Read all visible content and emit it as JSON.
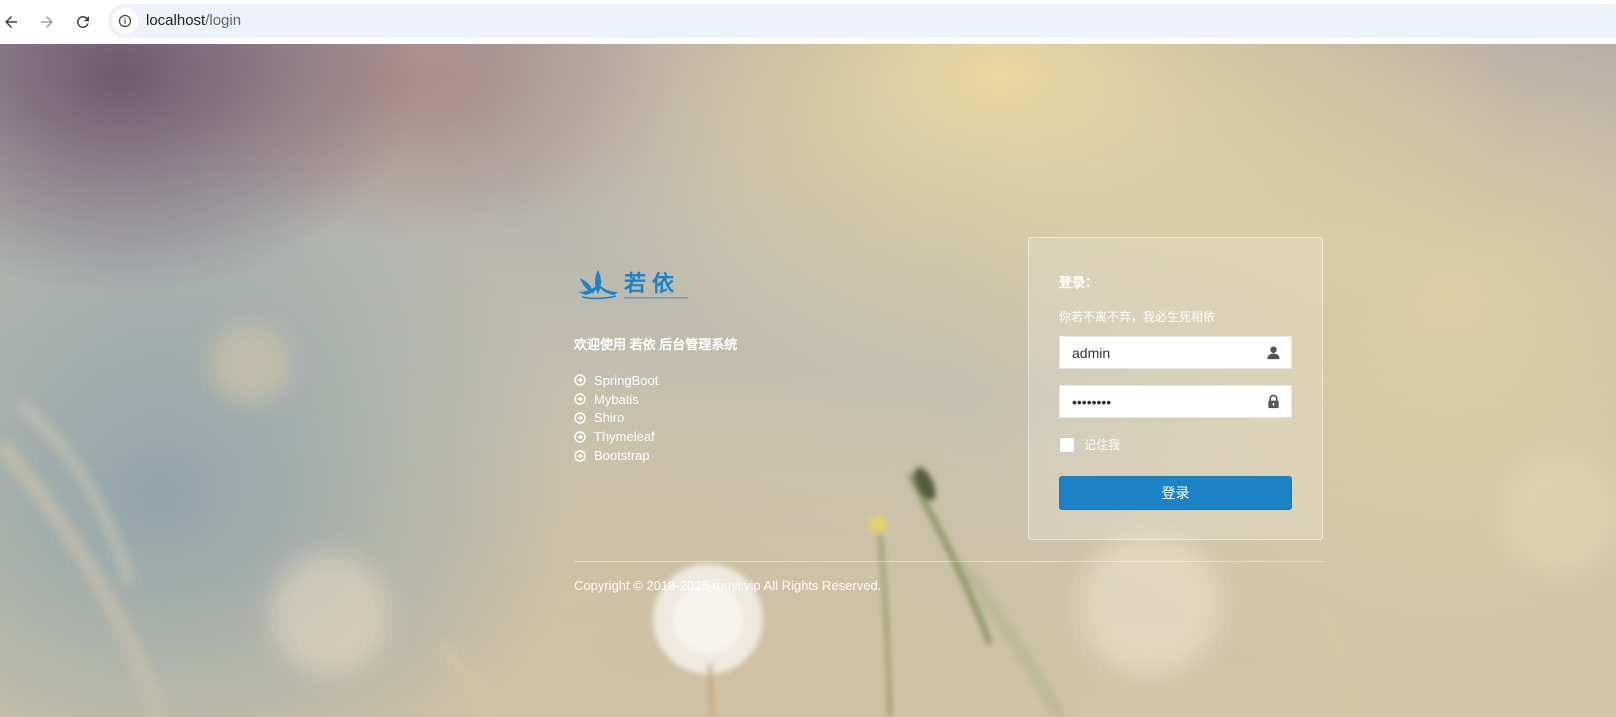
{
  "browser": {
    "url_host": "localhost",
    "url_path": "/login",
    "icons": {
      "back": "arrow-left-icon",
      "forward": "arrow-right-icon",
      "reload": "reload-icon",
      "site_info": "info-circle-icon"
    }
  },
  "brand": {
    "logo_text": "若依",
    "logo_color": "#1c84c6",
    "welcome": "欢迎使用 若依 后台管理系统"
  },
  "features": [
    {
      "label": "SpringBoot"
    },
    {
      "label": "Mybatis"
    },
    {
      "label": "Shiro"
    },
    {
      "label": "Thymeleaf"
    },
    {
      "label": "Bootstrap"
    }
  ],
  "login": {
    "title": "登录：",
    "subtitle": "你若不离不弃，我必生死相依",
    "username_value": "admin",
    "password_value": "admin123",
    "remember_label": "记住我",
    "remember_checked": false,
    "submit_label": "登录",
    "button_color": "#1c84c6",
    "icons": {
      "username": "user-icon",
      "password": "lock-icon"
    }
  },
  "footer": {
    "copyright": "Copyright © 2018-2025 ruoyi.vip All Rights Reserved."
  }
}
